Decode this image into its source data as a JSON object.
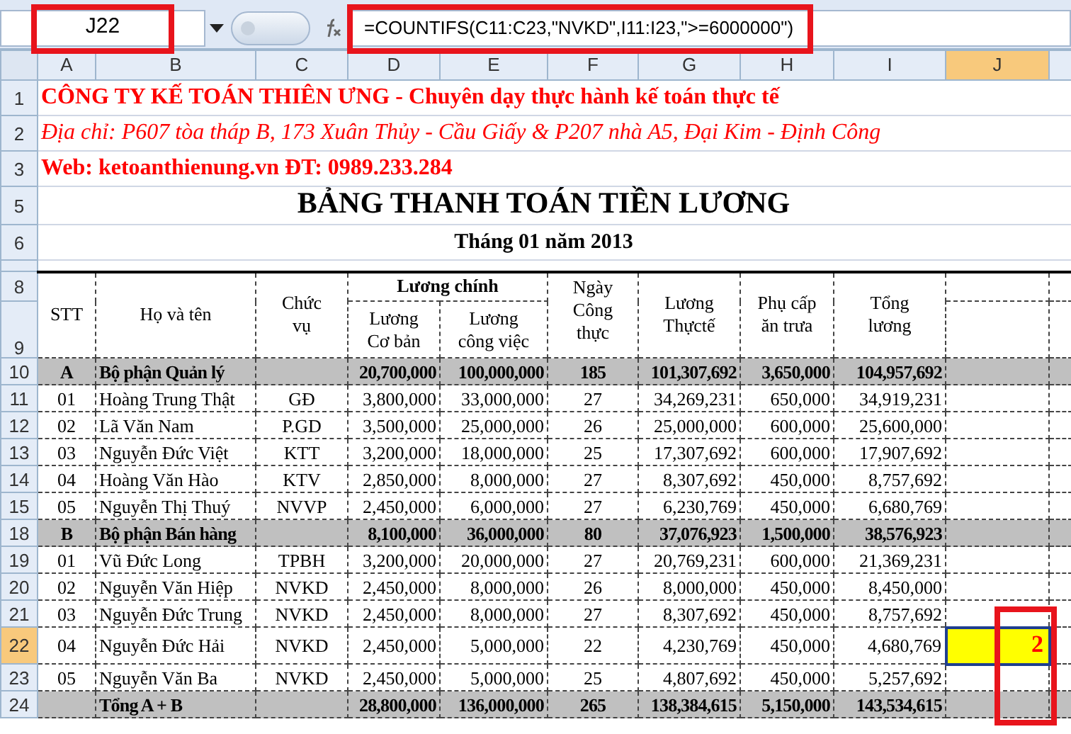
{
  "formula_bar": {
    "name_box": "J22",
    "formula": "=COUNTIFS(C11:C23,\"NVKD\",I11:I23,\">=6000000\")"
  },
  "column_headers": [
    {
      "label": "A",
      "selected": false
    },
    {
      "label": "B",
      "selected": false
    },
    {
      "label": "C",
      "selected": false
    },
    {
      "label": "D",
      "selected": false
    },
    {
      "label": "E",
      "selected": false
    },
    {
      "label": "F",
      "selected": false
    },
    {
      "label": "G",
      "selected": false
    },
    {
      "label": "H",
      "selected": false
    },
    {
      "label": "I",
      "selected": false
    },
    {
      "label": "J",
      "selected": true
    }
  ],
  "info_rows": [
    {
      "number": "1",
      "kind": "company",
      "text": "CÔNG TY KẾ TOÁN THIÊN ƯNG - Chuyên dạy thực hành kế toán thực tế"
    },
    {
      "number": "2",
      "kind": "address",
      "text": "Địa chỉ: P607 tòa tháp B, 173 Xuân Thủy - Cầu Giấy & P207 nhà A5, Đại Kim - Định Công"
    },
    {
      "number": "3",
      "kind": "company",
      "text": "Web: ketoanthienung.vn  ĐT: 0989.233.284"
    },
    {
      "number": "5",
      "kind": "title",
      "text": "BẢNG THANH TOÁN TIỀN LƯƠNG"
    },
    {
      "number": "6",
      "kind": "subtitle",
      "text": "Tháng 01 năm 2013"
    }
  ],
  "header": {
    "row_numbers": [
      "8",
      "9"
    ],
    "stt": "STT",
    "name": "Họ và tên",
    "position": "Chức\nvụ",
    "main_salary": "Lương chính",
    "base_salary": "Lương\nCơ bản",
    "job_salary": "Lương\ncông việc",
    "days": "Ngày\nCông\nthực",
    "actual_salary": "Lương\nThựctế",
    "lunch_allowance": "Phụ cấp\năn trưa",
    "total_salary": "Tổng\nlương"
  },
  "rows": [
    {
      "number": "10",
      "kind": "group",
      "selected": false,
      "cells": [
        "A",
        "Bộ phận Quản lý",
        "",
        "20,700,000",
        "100,000,000",
        "185",
        "101,307,692",
        "3,650,000",
        "104,957,692"
      ]
    },
    {
      "number": "11",
      "kind": "item",
      "selected": false,
      "cells": [
        "01",
        "Hoàng Trung Thật",
        "GĐ",
        "3,800,000",
        "33,000,000",
        "27",
        "34,269,231",
        "650,000",
        "34,919,231"
      ]
    },
    {
      "number": "12",
      "kind": "item",
      "selected": false,
      "cells": [
        "02",
        "Lã Văn Nam",
        "P.GD",
        "3,500,000",
        "25,000,000",
        "26",
        "25,000,000",
        "600,000",
        "25,600,000"
      ]
    },
    {
      "number": "13",
      "kind": "item",
      "selected": false,
      "cells": [
        "03",
        "Nguyễn Đức Việt",
        "KTT",
        "3,200,000",
        "18,000,000",
        "25",
        "17,307,692",
        "600,000",
        "17,907,692"
      ]
    },
    {
      "number": "14",
      "kind": "item",
      "selected": false,
      "cells": [
        "04",
        "Hoàng Văn Hào",
        "KTV",
        "2,850,000",
        "8,000,000",
        "27",
        "8,307,692",
        "450,000",
        "8,757,692"
      ]
    },
    {
      "number": "15",
      "kind": "item",
      "selected": false,
      "cells": [
        "05",
        "Nguyễn Thị Thuý",
        "NVVP",
        "2,450,000",
        "6,000,000",
        "27",
        "6,230,769",
        "450,000",
        "6,680,769"
      ]
    },
    {
      "number": "18",
      "kind": "group",
      "selected": false,
      "cells": [
        "B",
        "Bộ phận Bán hàng",
        "",
        "8,100,000",
        "36,000,000",
        "80",
        "37,076,923",
        "1,500,000",
        "38,576,923"
      ]
    },
    {
      "number": "19",
      "kind": "item",
      "selected": false,
      "cells": [
        "01",
        "Vũ Đức Long",
        "TPBH",
        "3,200,000",
        "20,000,000",
        "27",
        "20,769,231",
        "600,000",
        "21,369,231"
      ]
    },
    {
      "number": "20",
      "kind": "item",
      "selected": false,
      "cells": [
        "02",
        "Nguyễn Văn Hiệp",
        "NVKD",
        "2,450,000",
        "8,000,000",
        "26",
        "8,000,000",
        "450,000",
        "8,450,000"
      ]
    },
    {
      "number": "21",
      "kind": "item",
      "selected": false,
      "cells": [
        "03",
        "Nguyễn Đức Trung",
        "NVKD",
        "2,450,000",
        "8,000,000",
        "27",
        "8,307,692",
        "450,000",
        "8,757,692"
      ]
    },
    {
      "number": "22",
      "kind": "item",
      "selected": true,
      "result": "2",
      "cells": [
        "04",
        "Nguyễn Đức Hải",
        "NVKD",
        "2,450,000",
        "5,000,000",
        "22",
        "4,230,769",
        "450,000",
        "4,680,769"
      ]
    },
    {
      "number": "23",
      "kind": "item",
      "selected": false,
      "cells": [
        "05",
        "Nguyễn Văn Ba",
        "NVKD",
        "2,450,000",
        "5,000,000",
        "25",
        "4,807,692",
        "450,000",
        "5,257,692"
      ]
    },
    {
      "number": "24",
      "kind": "total",
      "selected": false,
      "cells": [
        "",
        "Tổng A + B",
        "",
        "28,800,000",
        "136,000,000",
        "265",
        "138,384,615",
        "5,150,000",
        "143,534,615"
      ]
    }
  ]
}
